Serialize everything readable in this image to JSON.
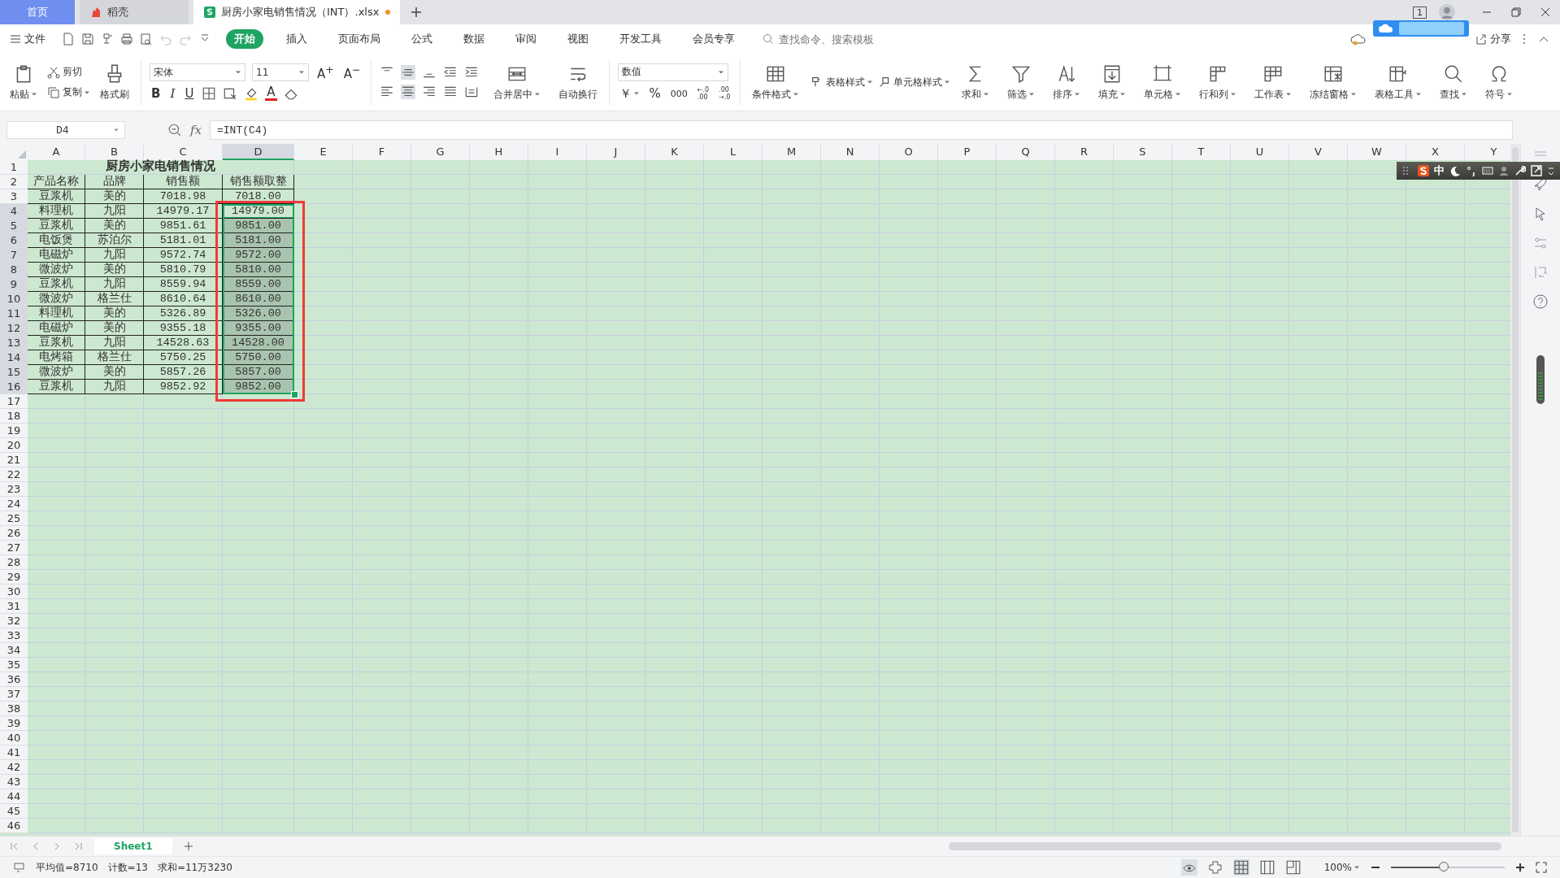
{
  "tabs": [
    {
      "label": "首页",
      "kind": "home",
      "selected": false
    },
    {
      "label": "稻壳",
      "kind": "docer",
      "selected": false
    },
    {
      "label": "厨房小家电销售情况（INT）.xlsx",
      "kind": "sheet",
      "selected": true,
      "unsaved": true
    }
  ],
  "title_bar": {
    "window_count": "1"
  },
  "menu": {
    "file": "文件",
    "tabs": [
      {
        "label": "开始",
        "selected": true
      },
      {
        "label": "插入",
        "selected": false
      },
      {
        "label": "页面布局",
        "selected": false
      },
      {
        "label": "公式",
        "selected": false
      },
      {
        "label": "数据",
        "selected": false
      },
      {
        "label": "审阅",
        "selected": false
      },
      {
        "label": "视图",
        "selected": false
      },
      {
        "label": "开发工具",
        "selected": false
      },
      {
        "label": "会员专享",
        "selected": false
      }
    ],
    "search_placeholder": "查找命令、搜索模板",
    "share": "分享"
  },
  "ribbon": {
    "clipboard": {
      "paste": "粘贴",
      "cut": "剪切",
      "copy": "复制",
      "format_painter": "格式刷"
    },
    "font": {
      "name": "宋体",
      "size": "11",
      "grow": "A$^{+}$",
      "shrink": "A$^{−}$",
      "bold": "B",
      "italic": "I",
      "underline": "U",
      "color_letter": "A"
    },
    "align_buttons": [
      {
        "selected": false
      },
      {
        "selected": true
      },
      {
        "selected": false
      },
      {
        "selected": false
      },
      {
        "selected": false
      },
      {
        "selected": false
      },
      {
        "selected": true
      },
      {
        "selected": false
      },
      {
        "selected": false
      },
      {
        "selected": false
      }
    ],
    "merge": "合并居中",
    "wrap": "自动换行",
    "number": {
      "format": "数值",
      "currency": "￥",
      "percent": "%",
      "thousands": "000",
      "inc_decimal": [
        "←.0",
        ".00"
      ],
      "dec_decimal": [
        ".00",
        "→.0"
      ]
    },
    "tools": [
      {
        "label": "条件格式",
        "kind": "large"
      },
      {
        "label": "表格样式",
        "kind": "small"
      },
      {
        "label": "单元格样式",
        "kind": "small"
      },
      {
        "label": "求和",
        "kind": "large"
      },
      {
        "label": "筛选",
        "kind": "large"
      },
      {
        "label": "排序",
        "kind": "large"
      },
      {
        "label": "填充",
        "kind": "large"
      },
      {
        "label": "单元格",
        "kind": "large"
      },
      {
        "label": "行和列",
        "kind": "large"
      },
      {
        "label": "工作表",
        "kind": "large"
      },
      {
        "label": "冻结窗格",
        "kind": "large"
      },
      {
        "label": "表格工具",
        "kind": "large"
      },
      {
        "label": "查找",
        "kind": "large"
      },
      {
        "label": "符号",
        "kind": "large"
      }
    ]
  },
  "formula_bar": {
    "name_box": "D4",
    "fx": "fx",
    "formula": "=INT(C4)"
  },
  "ime_bar": {
    "mode": "中"
  },
  "sheet": {
    "columns": [
      {
        "label": "A",
        "selected": false
      },
      {
        "label": "B",
        "selected": false
      },
      {
        "label": "C",
        "selected": false
      },
      {
        "label": "D",
        "selected": true
      },
      {
        "label": "E",
        "selected": false
      },
      {
        "label": "F",
        "selected": false
      },
      {
        "label": "G",
        "selected": false
      },
      {
        "label": "H",
        "selected": false
      },
      {
        "label": "I",
        "selected": false
      },
      {
        "label": "J",
        "selected": false
      },
      {
        "label": "K",
        "selected": false
      },
      {
        "label": "L",
        "selected": false
      },
      {
        "label": "M",
        "selected": false
      },
      {
        "label": "N",
        "selected": false
      },
      {
        "label": "O",
        "selected": false
      },
      {
        "label": "P",
        "selected": false
      },
      {
        "label": "Q",
        "selected": false
      },
      {
        "label": "R",
        "selected": false
      },
      {
        "label": "S",
        "selected": false
      },
      {
        "label": "T",
        "selected": false
      },
      {
        "label": "U",
        "selected": false
      },
      {
        "label": "V",
        "selected": false
      },
      {
        "label": "W",
        "selected": false
      },
      {
        "label": "X",
        "selected": false
      },
      {
        "label": "Y",
        "selected": false
      }
    ],
    "row_numbers": [
      "1",
      "2",
      "3",
      "4",
      "5",
      "6",
      "7",
      "8",
      "9",
      "10",
      "11",
      "12",
      "13",
      "14",
      "15",
      "16",
      "17",
      "18",
      "19",
      "20",
      "21",
      "22",
      "23",
      "24",
      "25",
      "26",
      "27",
      "28",
      "29",
      "30",
      "31",
      "32",
      "33",
      "34",
      "35",
      "36",
      "37",
      "38",
      "39",
      "40",
      "41",
      "42",
      "43",
      "44",
      "45",
      "46"
    ],
    "rows": [
      {
        "kind": "title",
        "title": "厨房小家电销售情况"
      },
      {
        "kind": "header",
        "cells": [
          "产品名称",
          "品牌",
          "销售额",
          "销售额取整"
        ]
      },
      {
        "kind": "data",
        "cells": [
          "豆浆机",
          "美的",
          "7018.98",
          "7018.00"
        ],
        "selected": false,
        "active": false
      },
      {
        "kind": "data",
        "cells": [
          "料理机",
          "九阳",
          "14979.17",
          "14979.00"
        ],
        "selected": true,
        "active": true
      },
      {
        "kind": "data",
        "cells": [
          "豆浆机",
          "美的",
          "9851.61",
          "9851.00"
        ],
        "selected": true,
        "active": false
      },
      {
        "kind": "data",
        "cells": [
          "电饭煲",
          "苏泊尔",
          "5181.01",
          "5181.00"
        ],
        "selected": true,
        "active": false
      },
      {
        "kind": "data",
        "cells": [
          "电磁炉",
          "九阳",
          "9572.74",
          "9572.00"
        ],
        "selected": true,
        "active": false
      },
      {
        "kind": "data",
        "cells": [
          "微波炉",
          "美的",
          "5810.79",
          "5810.00"
        ],
        "selected": true,
        "active": false
      },
      {
        "kind": "data",
        "cells": [
          "豆浆机",
          "九阳",
          "8559.94",
          "8559.00"
        ],
        "selected": true,
        "active": false
      },
      {
        "kind": "data",
        "cells": [
          "微波炉",
          "格兰仕",
          "8610.64",
          "8610.00"
        ],
        "selected": true,
        "active": false
      },
      {
        "kind": "data",
        "cells": [
          "料理机",
          "美的",
          "5326.89",
          "5326.00"
        ],
        "selected": true,
        "active": false
      },
      {
        "kind": "data",
        "cells": [
          "电磁炉",
          "美的",
          "9355.18",
          "9355.00"
        ],
        "selected": true,
        "active": false
      },
      {
        "kind": "data",
        "cells": [
          "豆浆机",
          "九阳",
          "14528.63",
          "14528.00"
        ],
        "selected": true,
        "active": false
      },
      {
        "kind": "data",
        "cells": [
          "电烤箱",
          "格兰仕",
          "5750.25",
          "5750.00"
        ],
        "selected": true,
        "active": false
      },
      {
        "kind": "data",
        "cells": [
          "微波炉",
          "美的",
          "5857.26",
          "5857.00"
        ],
        "selected": true,
        "active": false
      },
      {
        "kind": "data",
        "cells": [
          "豆浆机",
          "九阳",
          "9852.92",
          "9852.00"
        ],
        "selected": true,
        "active": false
      }
    ],
    "annotation_frame": true
  },
  "sheet_tabs": [
    {
      "label": "Sheet1",
      "selected": true
    }
  ],
  "status_bar": {
    "average": "平均值=8710",
    "count": "计数=13",
    "sum": "求和=11万3230",
    "eye_care_on": true,
    "view_modes": [
      {
        "selected": true
      },
      {
        "selected": false
      },
      {
        "selected": false
      }
    ],
    "zoom": "100%",
    "zoom_slider": {
      "level": 0.47
    }
  }
}
